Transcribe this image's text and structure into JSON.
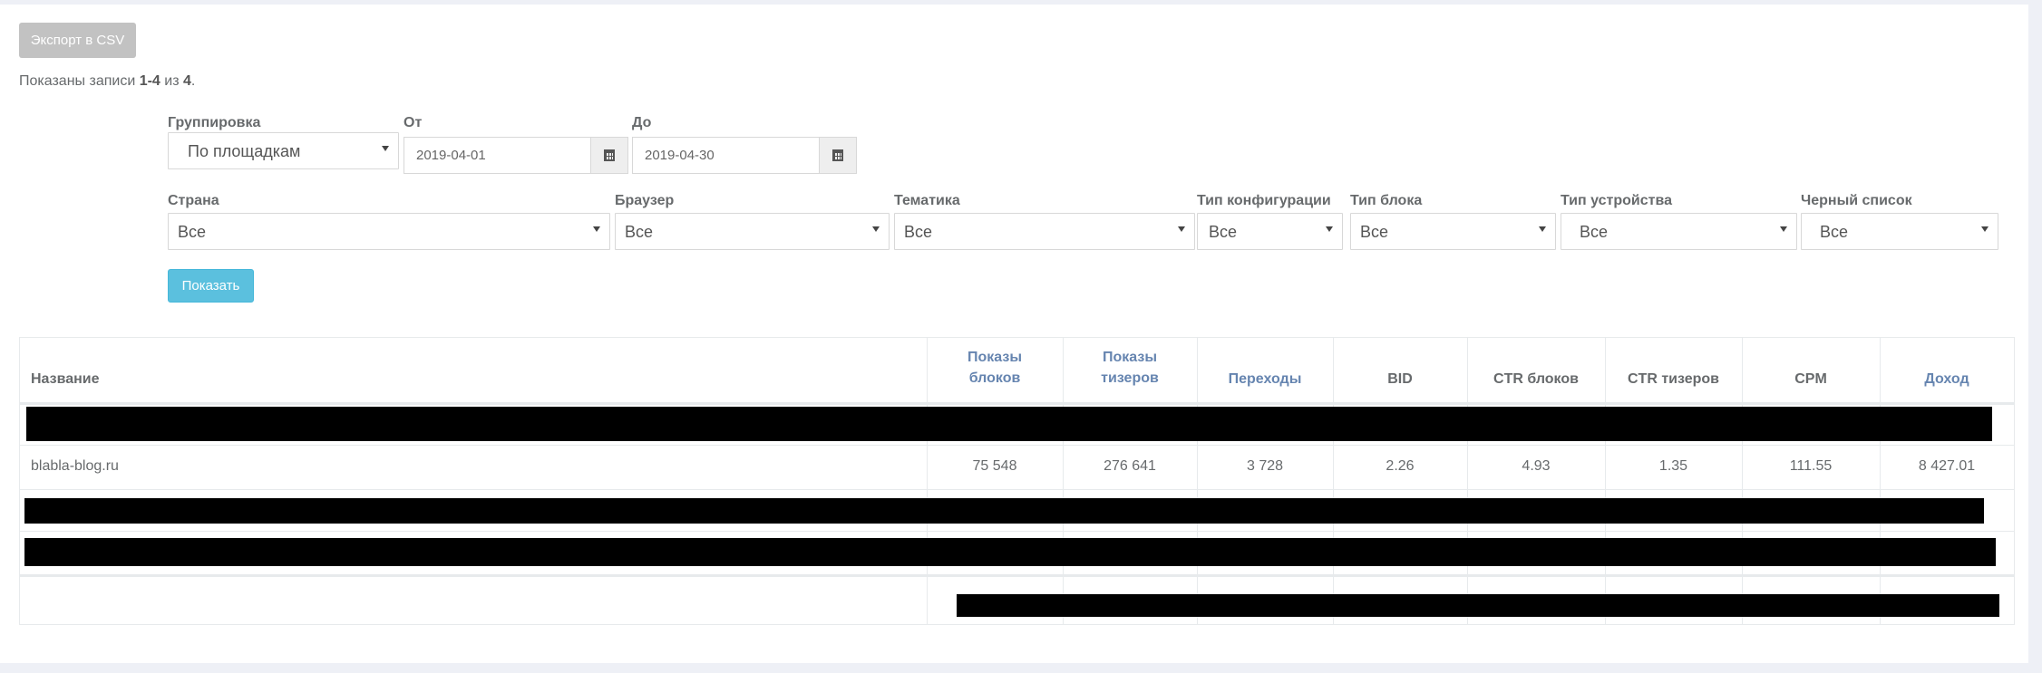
{
  "toolbar": {
    "export_label": "Экспорт в CSV"
  },
  "records": {
    "prefix": "Показаны записи ",
    "range": "1-4",
    "mid": " из ",
    "total": "4",
    "suffix": "."
  },
  "filters": {
    "grouping": {
      "label": "Группировка",
      "value": "По площадкам"
    },
    "from": {
      "label": "От",
      "value": "2019-04-01"
    },
    "to": {
      "label": "До",
      "value": "2019-04-30"
    },
    "country": {
      "label": "Страна",
      "value": "Все"
    },
    "browser": {
      "label": "Браузер",
      "value": "Все"
    },
    "topic": {
      "label": "Тематика",
      "value": "Все"
    },
    "config_type": {
      "label": "Тип конфигурации",
      "value": "Все"
    },
    "block_type": {
      "label": "Тип блока",
      "value": "Все"
    },
    "device_type": {
      "label": "Тип устройства",
      "value": "Все"
    },
    "blacklist": {
      "label": "Черный список",
      "value": "Все"
    },
    "show_label": "Показать"
  },
  "table": {
    "headers": {
      "name": "Название",
      "block_impressions_1": "Показы",
      "block_impressions_2": "блоков",
      "teaser_impressions_1": "Показы",
      "teaser_impressions_2": "тизеров",
      "clicks": "Переходы",
      "bid": "BID",
      "ctr_blocks": "CTR блоков",
      "ctr_teasers": "CTR тизеров",
      "cpm": "CPM",
      "income": "Доход"
    },
    "rows": [
      {
        "name": "blabla-blog.ru",
        "block_impressions": "75 548",
        "teaser_impressions": "276 641",
        "clicks": "3 728",
        "bid": "2.26",
        "ctr_blocks": "4.93",
        "ctr_teasers": "1.35",
        "cpm": "111.55",
        "income": "8 427.01"
      }
    ]
  },
  "colors": {
    "link_header": "#6685b0",
    "show_button": "#5bc0de",
    "export_button": "#c2c2c2"
  }
}
